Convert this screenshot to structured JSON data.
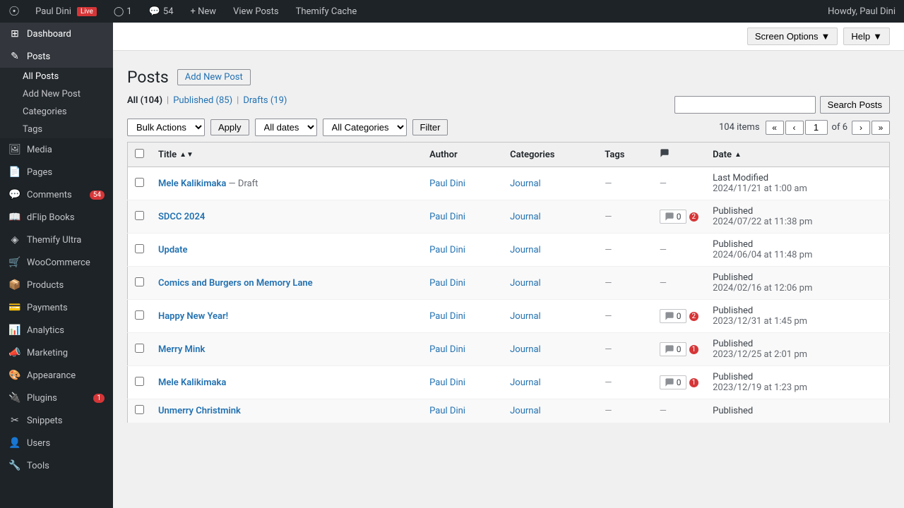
{
  "adminbar": {
    "logo": "W",
    "site_name": "Paul Dini",
    "live_label": "Live",
    "updates_count": "1",
    "comments_count": "54",
    "new_label": "+ New",
    "view_posts_label": "View Posts",
    "themify_cache_label": "Themify Cache",
    "howdy": "Howdy, Paul Dini"
  },
  "screen_options": {
    "label": "Screen Options",
    "arrow": "▼"
  },
  "help": {
    "label": "Help",
    "arrow": "▼"
  },
  "sidebar": {
    "items": [
      {
        "id": "dashboard",
        "icon": "⊞",
        "label": "Dashboard"
      },
      {
        "id": "posts",
        "icon": "✎",
        "label": "Posts",
        "active": true
      },
      {
        "id": "media",
        "icon": "🖼",
        "label": "Media"
      },
      {
        "id": "pages",
        "icon": "📄",
        "label": "Pages"
      },
      {
        "id": "comments",
        "icon": "💬",
        "label": "Comments",
        "badge": "54"
      },
      {
        "id": "dflip",
        "icon": "📖",
        "label": "dFlip Books"
      },
      {
        "id": "themify",
        "icon": "◈",
        "label": "Themify Ultra"
      },
      {
        "id": "woocommerce",
        "icon": "🛒",
        "label": "WooCommerce"
      },
      {
        "id": "products",
        "icon": "📦",
        "label": "Products"
      },
      {
        "id": "payments",
        "icon": "💳",
        "label": "Payments"
      },
      {
        "id": "analytics",
        "icon": "📊",
        "label": "Analytics"
      },
      {
        "id": "marketing",
        "icon": "📣",
        "label": "Marketing"
      },
      {
        "id": "appearance",
        "icon": "🎨",
        "label": "Appearance"
      },
      {
        "id": "plugins",
        "icon": "🔌",
        "label": "Plugins",
        "badge": "1"
      },
      {
        "id": "snippets",
        "icon": "✂",
        "label": "Snippets"
      },
      {
        "id": "users",
        "icon": "👤",
        "label": "Users"
      },
      {
        "id": "tools",
        "icon": "🔧",
        "label": "Tools"
      }
    ],
    "submenu": [
      {
        "id": "all-posts",
        "label": "All Posts",
        "active": true
      },
      {
        "id": "add-new",
        "label": "Add New Post"
      },
      {
        "id": "categories",
        "label": "Categories"
      },
      {
        "id": "tags",
        "label": "Tags"
      }
    ]
  },
  "page": {
    "title": "Posts",
    "add_new_label": "Add New Post"
  },
  "filters": {
    "all_label": "All",
    "all_count": "(104)",
    "published_label": "Published",
    "published_count": "(85)",
    "drafts_label": "Drafts",
    "drafts_count": "(19)"
  },
  "search": {
    "placeholder": "",
    "button_label": "Search Posts"
  },
  "tablenav": {
    "bulk_actions_label": "Bulk Actions",
    "all_dates_label": "All dates",
    "all_categories_label": "All Categories",
    "apply_label": "Apply",
    "filter_label": "Filter",
    "items_count": "104 items",
    "of_label": "of 6",
    "current_page": "1"
  },
  "table": {
    "columns": [
      {
        "id": "cb",
        "label": ""
      },
      {
        "id": "title",
        "label": "Title",
        "sortable": true
      },
      {
        "id": "author",
        "label": "Author"
      },
      {
        "id": "categories",
        "label": "Categories"
      },
      {
        "id": "tags",
        "label": "Tags"
      },
      {
        "id": "comments",
        "label": "💬",
        "sortable": true
      },
      {
        "id": "date",
        "label": "Date",
        "sortable": true
      }
    ],
    "rows": [
      {
        "id": 1,
        "title": "Mele Kalikimaka",
        "title_suffix": " — Draft",
        "author": "Paul Dini",
        "category": "Journal",
        "tags": "—",
        "comments": null,
        "date_status": "Last Modified",
        "date_value": "2024/11/21 at 1:00 am"
      },
      {
        "id": 2,
        "title": "SDCC 2024",
        "title_suffix": "",
        "author": "Paul Dini",
        "category": "Journal",
        "tags": "—",
        "comments": {
          "pending": 0,
          "total": 2
        },
        "date_status": "Published",
        "date_value": "2024/07/22 at 11:38 pm"
      },
      {
        "id": 3,
        "title": "Update",
        "title_suffix": "",
        "author": "Paul Dini",
        "category": "Journal",
        "tags": "—",
        "comments": null,
        "date_status": "Published",
        "date_value": "2024/06/04 at 11:48 pm"
      },
      {
        "id": 4,
        "title": "Comics and Burgers on Memory Lane",
        "title_suffix": "",
        "author": "Paul Dini",
        "category": "Journal",
        "tags": "—",
        "comments": null,
        "date_status": "Published",
        "date_value": "2024/02/16 at 12:06 pm"
      },
      {
        "id": 5,
        "title": "Happy New Year!",
        "title_suffix": "",
        "author": "Paul Dini",
        "category": "Journal",
        "tags": "—",
        "comments": {
          "pending": 0,
          "total": 2
        },
        "date_status": "Published",
        "date_value": "2023/12/31 at 1:45 pm"
      },
      {
        "id": 6,
        "title": "Merry Mink",
        "title_suffix": "",
        "author": "Paul Dini",
        "category": "Journal",
        "tags": "—",
        "comments": {
          "pending": 0,
          "total": 1
        },
        "date_status": "Published",
        "date_value": "2023/12/25 at 2:01 pm"
      },
      {
        "id": 7,
        "title": "Mele Kalikimaka",
        "title_suffix": "",
        "author": "Paul Dini",
        "category": "Journal",
        "tags": "—",
        "comments": {
          "pending": 0,
          "total": 1
        },
        "date_status": "Published",
        "date_value": "2023/12/19 at 1:23 pm"
      },
      {
        "id": 8,
        "title": "Unmerry Christmink",
        "title_suffix": "",
        "author": "Paul Dini",
        "category": "Journal",
        "tags": "—",
        "comments": null,
        "date_status": "Published",
        "date_value": ""
      }
    ]
  },
  "colors": {
    "sidebar_bg": "#1d2327",
    "active_blue": "#2271b1",
    "link_blue": "#2271b1",
    "badge_red": "#d63638"
  }
}
